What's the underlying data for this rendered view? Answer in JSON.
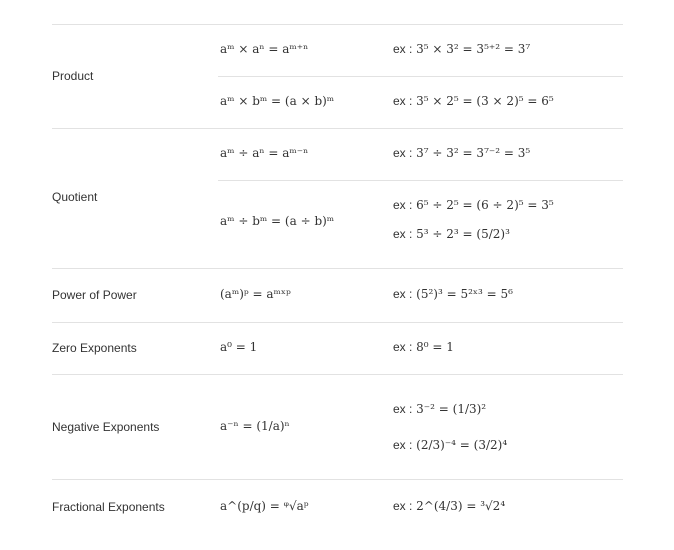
{
  "rules": [
    {
      "label": "Product",
      "rows": [
        {
          "formula": "aᵐ × aⁿ = aᵐ⁺ⁿ",
          "examples": [
            "3⁵ × 3² = 3⁵⁺² = 3⁷"
          ]
        },
        {
          "formula": "aᵐ × bᵐ = (a × b)ᵐ",
          "examples": [
            "3⁵ × 2⁵ = (3 × 2)⁵ = 6⁵"
          ]
        }
      ]
    },
    {
      "label": "Quotient",
      "rows": [
        {
          "formula": "aᵐ ÷ aⁿ = aᵐ⁻ⁿ",
          "examples": [
            "3⁷ ÷ 3² = 3⁷⁻² = 3⁵"
          ]
        },
        {
          "formula": "aᵐ ÷ bᵐ = (a ÷ b)ᵐ",
          "examples": [
            "6⁵ ÷ 2⁵ = (6 ÷ 2)⁵ = 3⁵",
            "5³ ÷ 2³ = (5/2)³"
          ]
        }
      ]
    },
    {
      "label": "Power of Power",
      "rows": [
        {
          "formula": "(aᵐ)ᵖ = aᵐˣᵖ",
          "examples": [
            "(5²)³ = 5²ˣ³ = 5⁶"
          ]
        }
      ]
    },
    {
      "label": "Zero Exponents",
      "rows": [
        {
          "formula": "a⁰ = 1",
          "examples": [
            "8⁰ = 1"
          ]
        }
      ]
    },
    {
      "label": "Negative Exponents",
      "rows": [
        {
          "formula": "a⁻ⁿ = (1/a)ⁿ",
          "examples": [
            "3⁻² = (1/3)²",
            "(2/3)⁻⁴ = (3/2)⁴"
          ]
        }
      ]
    },
    {
      "label": "Fractional Exponents",
      "rows": [
        {
          "formula": "a^(p/q) = ᵠ√aᵖ",
          "examples": [
            "2^(4/3) = ³√2⁴"
          ]
        }
      ]
    }
  ],
  "example_prefix": "ex :"
}
